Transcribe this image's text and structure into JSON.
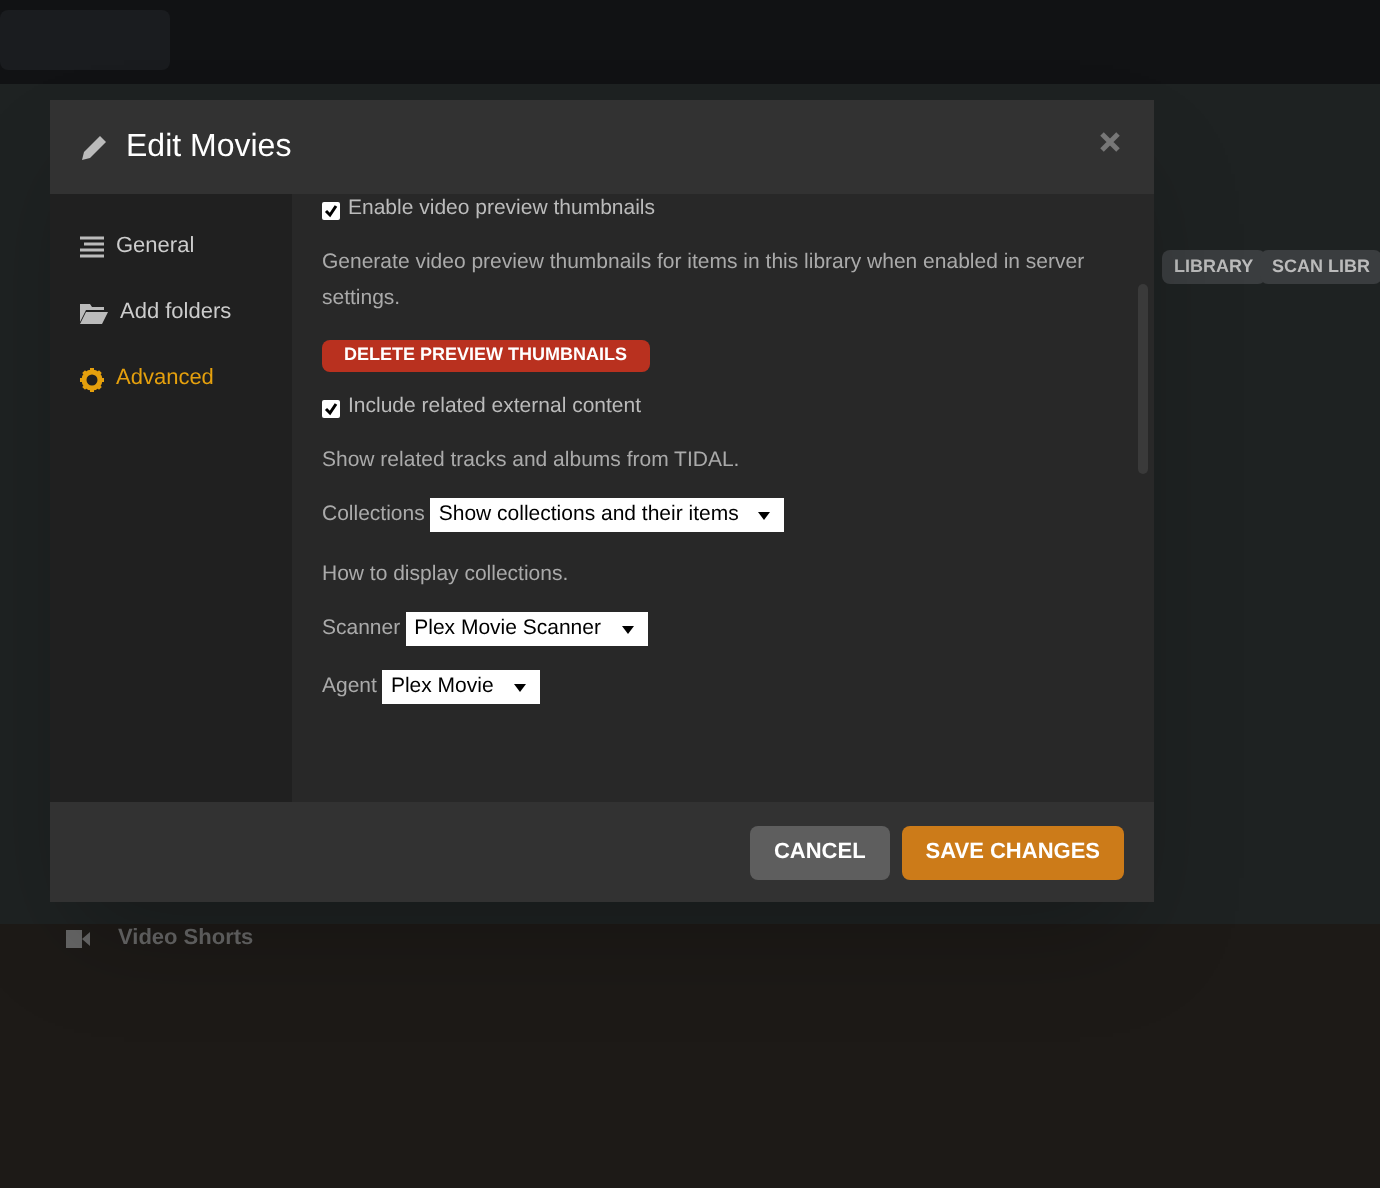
{
  "background": {
    "buttons": [
      "LIBRARY",
      "SCAN LIBR"
    ],
    "sidebar_item": "Video Shorts"
  },
  "dialog": {
    "title": "Edit Movies",
    "nav": [
      {
        "label": "General",
        "selected": false
      },
      {
        "label": "Add folders",
        "selected": false
      },
      {
        "label": "Advanced",
        "selected": true
      }
    ],
    "settings": [
      {
        "kind": "checkbox",
        "label": "Enable video preview thumbnails",
        "checked": true
      },
      {
        "kind": "help",
        "text": "Generate video preview thumbnails for items in this library when enabled in server settings."
      },
      {
        "kind": "danger-button",
        "label": "DELETE PREVIEW THUMBNAILS"
      },
      {
        "kind": "checkbox",
        "label": "Include related external content",
        "checked": true
      },
      {
        "kind": "help",
        "text": "Show related tracks and albums from TIDAL."
      },
      {
        "kind": "select",
        "label": "Collections",
        "value": "Show collections and their items"
      },
      {
        "kind": "help",
        "text": "How to display collections."
      },
      {
        "kind": "select",
        "label": "Scanner",
        "value": "Plex Movie Scanner"
      },
      {
        "kind": "select",
        "label": "Agent",
        "value": "Plex Movie"
      }
    ],
    "buttons": [
      {
        "label": "CANCEL",
        "kind": "secondary"
      },
      {
        "label": "SAVE CHANGES",
        "kind": "primary"
      }
    ]
  }
}
